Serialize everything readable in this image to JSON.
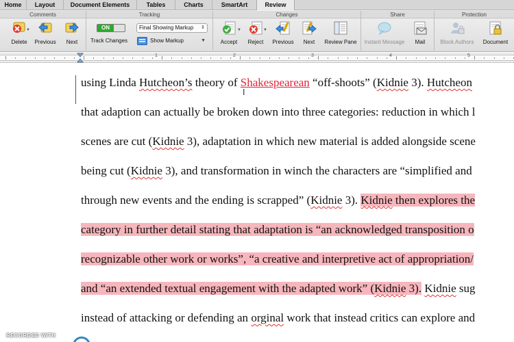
{
  "ribbon_tabs": [
    {
      "label": "Home"
    },
    {
      "label": "Layout"
    },
    {
      "label": "Document Elements"
    },
    {
      "label": "Tables"
    },
    {
      "label": "Charts"
    },
    {
      "label": "SmartArt"
    },
    {
      "label": "Review",
      "active": true
    }
  ],
  "groups": {
    "comments": "Comments",
    "tracking": "Tracking",
    "changes": "Changes",
    "share": "Share",
    "protection": "Protection"
  },
  "buttons": {
    "delete": "Delete",
    "previous_comment": "Previous",
    "next_comment": "Next",
    "track_changes": "Track Changes",
    "toggle_state": "ON",
    "markup_view": "Final Showing Markup",
    "show_markup": "Show Markup",
    "accept": "Accept",
    "reject": "Reject",
    "previous_change": "Previous",
    "next_change": "Next",
    "review_pane": "Review Pane",
    "instant_message": "Instant Message",
    "mail": "Mail",
    "block_authors": "Block Authors",
    "document": "Document"
  },
  "ruler": {
    "numbers": [
      "1",
      "2",
      "3",
      "4",
      "5"
    ]
  },
  "document": {
    "lines": [
      [
        {
          "t": "using Linda "
        },
        {
          "t": "Hutcheon’s",
          "sq": true
        },
        {
          "t": " theory of "
        },
        {
          "t": "Shakespearean",
          "ins": true
        },
        {
          "t": " “off-shoots” ("
        },
        {
          "t": "Kidnie",
          "sq": true
        },
        {
          "t": " 3). "
        },
        {
          "t": "Hutcheon",
          "sq": true
        }
      ],
      [
        {
          "t": "that adaption can actually be broken down into three categories: reduction in which l"
        }
      ],
      [
        {
          "t": "scenes are cut ("
        },
        {
          "t": "Kidnie",
          "sq": true
        },
        {
          "t": " 3), adaptation in which new material is added alongside scene"
        }
      ],
      [
        {
          "t": "being cut ("
        },
        {
          "t": "Kidnie",
          "sq": true
        },
        {
          "t": " 3), and transformation in winch the characters are “simplified and"
        }
      ],
      [
        {
          "t": "through new events and the ending is scrapped” ("
        },
        {
          "t": "Kidnie",
          "sq": true
        },
        {
          "t": " 3). "
        },
        {
          "t": "Kidnie",
          "sq": true,
          "hl": true
        },
        {
          "t": " then explores the",
          "hl": true
        }
      ],
      [
        {
          "t": "category in further detail stating that adaptation is “an acknowledged transposition o",
          "hl": true
        }
      ],
      [
        {
          "t": "recognizable other work or works”, “a creative and interpretive act of appropriation/",
          "hl": true
        }
      ],
      [
        {
          "t": "and “an extended textual engagement with the adapted work” (",
          "hl": true
        },
        {
          "t": "Kidnie",
          "sq": true,
          "hl": true
        },
        {
          "t": " 3).",
          "hl": true
        },
        {
          "t": " "
        },
        {
          "t": "Kidnie",
          "sq": true
        },
        {
          "t": " sug"
        }
      ],
      [
        {
          "t": "instead of attacking or defending an "
        },
        {
          "t": "orginal",
          "sq": true
        },
        {
          "t": " work that instead critics can explore and"
        }
      ]
    ]
  },
  "watermark": "RECORDED WITH",
  "colors": {
    "track_on": "#2eaa2e",
    "insertion": "#e0243a",
    "highlight": "#f6b6bc",
    "squiggle": "#dd3333"
  }
}
